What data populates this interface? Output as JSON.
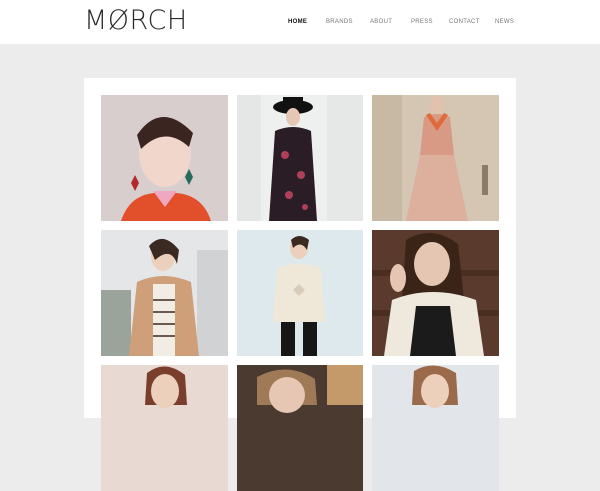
{
  "brand": {
    "logo_text": "MØRCH"
  },
  "nav": {
    "items": [
      {
        "label": "HOME",
        "active": true
      },
      {
        "label": "BRANDS",
        "active": false
      },
      {
        "label": "ABOUT",
        "active": false
      },
      {
        "label": "PRESS",
        "active": false
      },
      {
        "label": "CONTACT",
        "active": false
      },
      {
        "label": "NEWS",
        "active": false
      }
    ]
  },
  "gallery": {
    "tiles": [
      {
        "name": "portrait-orange-coat",
        "bg": "#d9cfcf",
        "accent": "#e0502a"
      },
      {
        "name": "black-hat-embroidered-coat",
        "bg": "#eef0ef",
        "accent": "#2b1c24"
      },
      {
        "name": "trench-dress-orange-scarf",
        "bg": "#d7c9b6",
        "accent": "#dca090"
      },
      {
        "name": "quilted-jacket-striped-top",
        "bg": "#e6e7e8",
        "accent": "#cf9f7a"
      },
      {
        "name": "cream-knit-sweater",
        "bg": "#dde9ec",
        "accent": "#eee6d5"
      },
      {
        "name": "white-sweater-black-overalls",
        "bg": "#5a3a2c",
        "accent": "#1b1b1b"
      },
      {
        "name": "partial-row-1",
        "bg": "#e8d9d2",
        "accent": "#8a4a36"
      },
      {
        "name": "partial-row-2",
        "bg": "#4a3a30",
        "accent": "#c49a6a"
      },
      {
        "name": "partial-row-3",
        "bg": "#e2e6ea",
        "accent": "#9a6a4a"
      }
    ]
  }
}
